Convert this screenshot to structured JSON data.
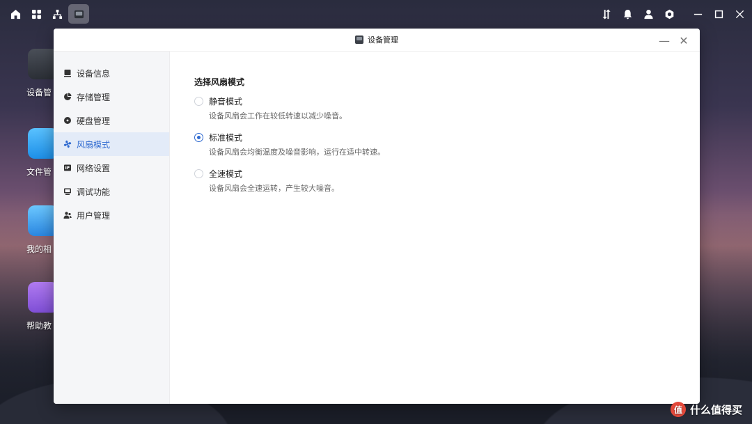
{
  "topbar": {
    "left_icons": [
      "home-icon",
      "apps-grid-icon",
      "network-icon",
      "device-manager-icon"
    ],
    "right_icons": [
      "transfer-icon",
      "bell-icon",
      "user-icon",
      "settings-icon"
    ],
    "window_controls": [
      "minimize-icon",
      "maximize-icon",
      "close-icon"
    ]
  },
  "desktop": {
    "icons": [
      {
        "label": "设备管",
        "icon": "device-icon"
      },
      {
        "label": "文件管",
        "icon": "folder-icon"
      },
      {
        "label": "我的相",
        "icon": "photos-icon"
      },
      {
        "label": "帮助教",
        "icon": "help-icon"
      }
    ]
  },
  "window": {
    "title": "设备管理",
    "minimize": "—",
    "close": "✕"
  },
  "sidebar": {
    "items": [
      {
        "label": "设备信息",
        "icon": "info-icon"
      },
      {
        "label": "存储管理",
        "icon": "pie-chart-icon"
      },
      {
        "label": "硬盘管理",
        "icon": "disk-icon"
      },
      {
        "label": "风扇模式",
        "icon": "fan-icon",
        "active": true
      },
      {
        "label": "网络设置",
        "icon": "network-ip-icon"
      },
      {
        "label": "调试功能",
        "icon": "debug-icon"
      },
      {
        "label": "用户管理",
        "icon": "users-icon"
      }
    ]
  },
  "main": {
    "section_title": "选择风扇模式",
    "options": [
      {
        "label": "静音模式",
        "desc": "设备风扇会工作在较低转速以减少噪音。",
        "checked": false
      },
      {
        "label": "标准模式",
        "desc": "设备风扇会均衡温度及噪音影响，运行在适中转速。",
        "checked": true
      },
      {
        "label": "全速模式",
        "desc": "设备风扇会全速运转，产生较大噪音。",
        "checked": false
      }
    ]
  },
  "watermark": {
    "logo_text": "值",
    "text": "什么值得买"
  },
  "colors": {
    "accent": "#2f6ad0",
    "sidebar_bg": "#f5f6f8",
    "active_bg": "#e3ebf8"
  }
}
